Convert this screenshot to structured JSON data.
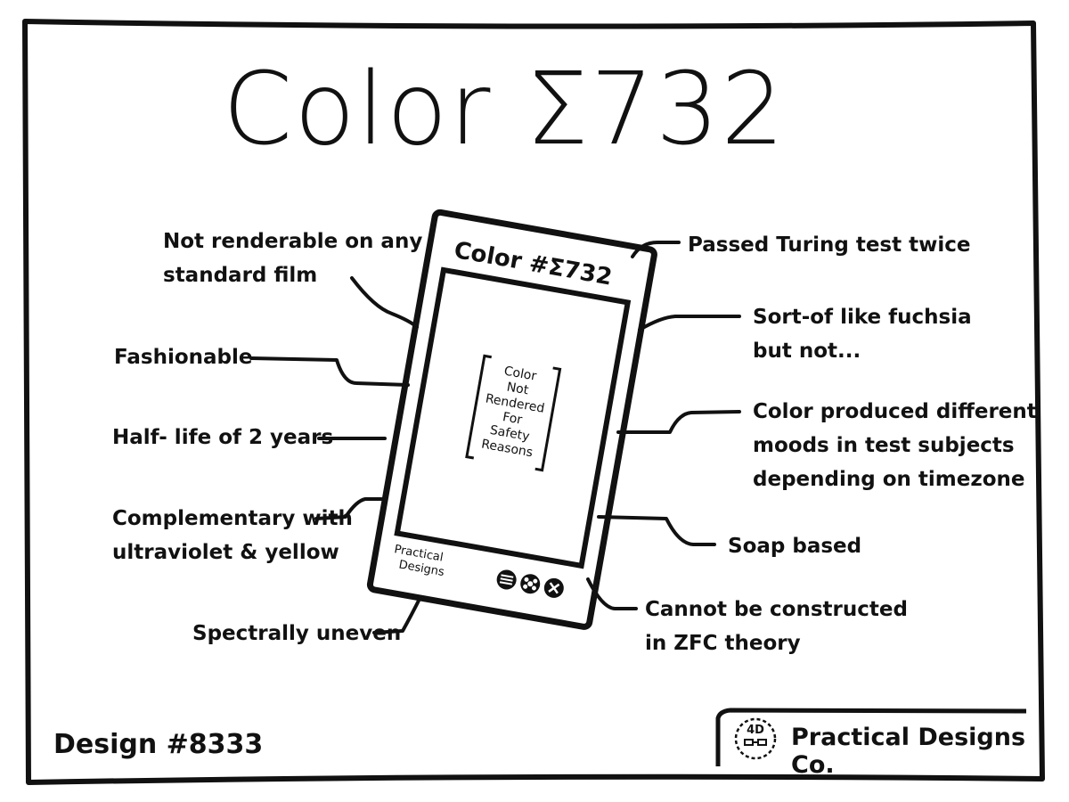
{
  "title": "Color Σ732",
  "device": {
    "header": "Color #Σ732",
    "screen_notice": [
      "Color",
      "Not",
      "Rendered",
      "For",
      "Safety",
      "Reasons"
    ],
    "brand_line1": "Practical",
    "brand_line2": "Designs",
    "buttons": [
      "menu-icon",
      "flower-icon",
      "close-icon"
    ]
  },
  "annotations": {
    "not_renderable": [
      "Not renderable on any",
      "standard film"
    ],
    "fashionable": [
      "Fashionable"
    ],
    "half_life": [
      "Half- life of 2 years"
    ],
    "complementary": [
      "Complementary with",
      "ultraviolet & yellow"
    ],
    "spectrally": [
      "Spectrally uneven"
    ],
    "turing": [
      "Passed Turing test twice"
    ],
    "fuchsia": [
      "Sort-of like fuchsia",
      "but not..."
    ],
    "moods": [
      "Color produced different",
      "moods in test subjects",
      "depending on timezone"
    ],
    "soap": [
      "Soap based"
    ],
    "zfc": [
      "Cannot be constructed",
      "in ZFC theory"
    ]
  },
  "footer": {
    "design_number": "Design #8333",
    "company": "Practical Designs Co.",
    "logo_text": "4D"
  }
}
